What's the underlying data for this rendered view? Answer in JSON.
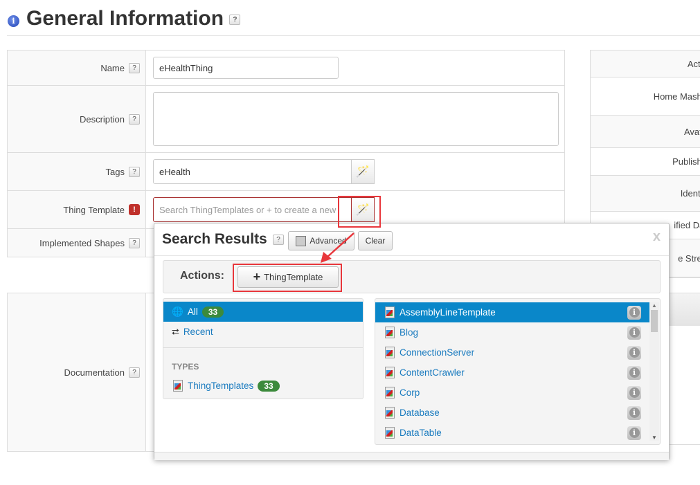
{
  "header": {
    "title": "General Information",
    "help": "?"
  },
  "form": {
    "name_label": "Name",
    "name_value": "eHealthThing",
    "description_label": "Description",
    "description_value": "",
    "tags_label": "Tags",
    "tags_value": "eHealth",
    "template_label": "Thing Template",
    "template_placeholder": "Search ThingTemplates or + to create a new",
    "required_mark": "!",
    "shapes_label": "Implemented Shapes",
    "documentation_label": "Documentation"
  },
  "right_panel": {
    "labels": [
      "Activ",
      "Home Mashu",
      "Avata",
      "Publishe",
      "Identifi",
      "ified Dat",
      "e Strea"
    ]
  },
  "popup": {
    "title": "Search Results",
    "help": "?",
    "advanced_label": "Advanced",
    "clear_label": "Clear",
    "close": "x",
    "actions_label": "Actions:",
    "add_button_label": "ThingTemplate",
    "filters": {
      "all_label": "All",
      "all_count": "33",
      "recent_label": "Recent",
      "types_heading": "TYPES",
      "type_label": "ThingTemplates",
      "type_count": "33"
    },
    "results": [
      "AssemblyLineTemplate",
      "Blog",
      "ConnectionServer",
      "ContentCrawler",
      "Corp",
      "Database",
      "DataTable"
    ],
    "selected_index": 0
  },
  "colors": {
    "accent": "#0a87c9",
    "badge": "#3c8a3c",
    "annotation": "#e8363b",
    "error": "#c0302b"
  }
}
